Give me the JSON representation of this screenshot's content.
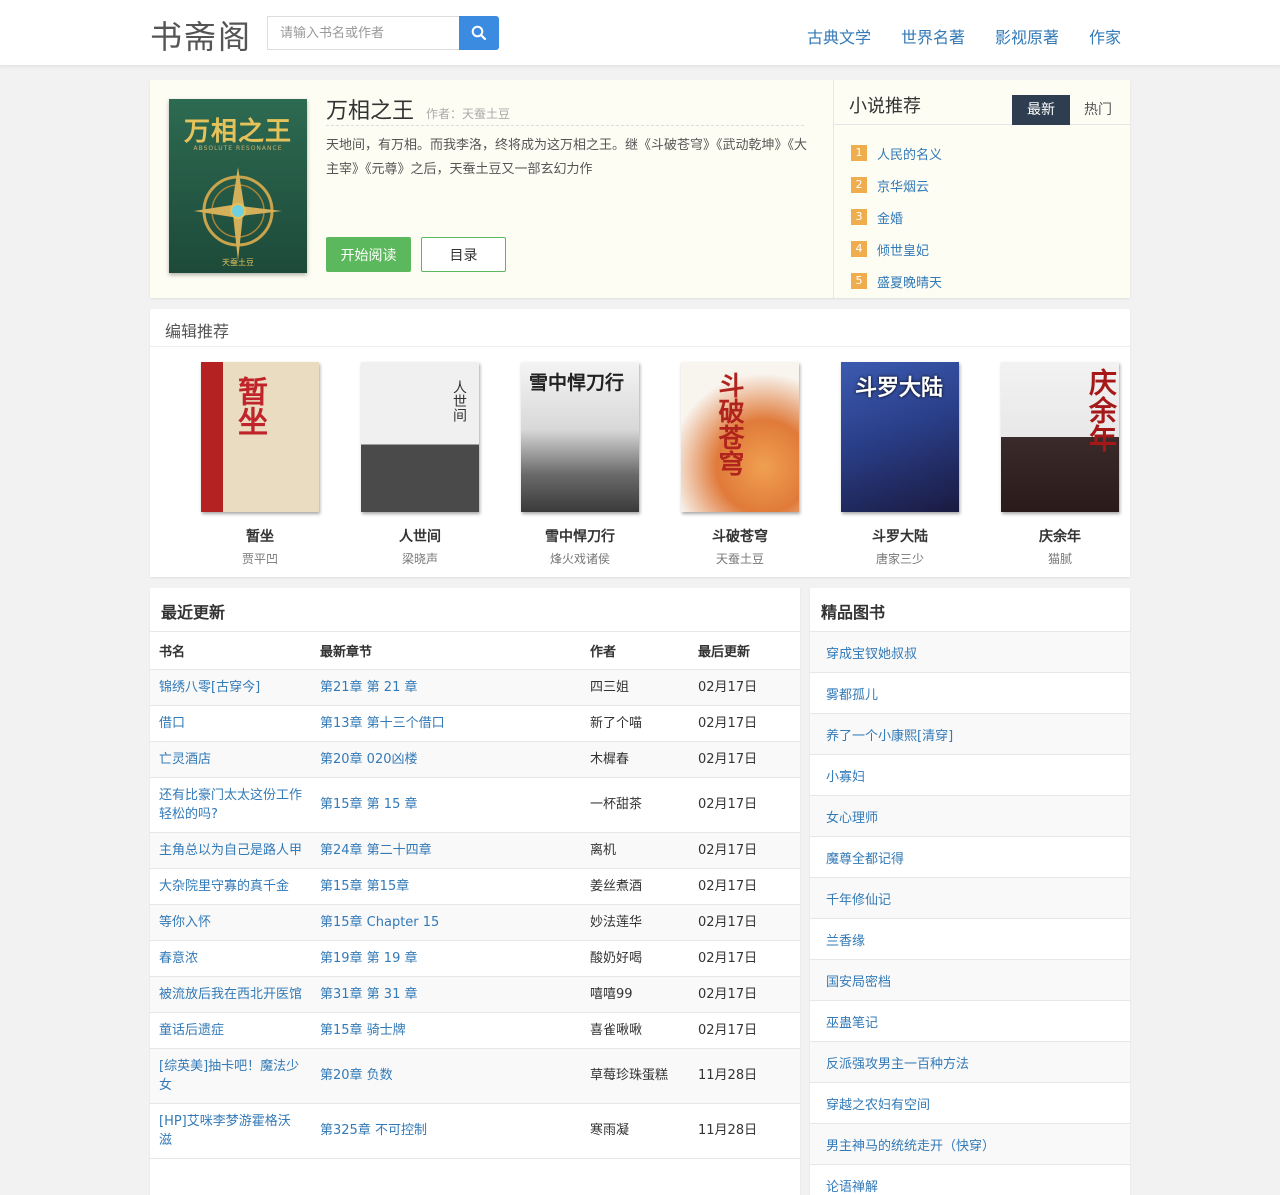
{
  "header": {
    "logo": "书斋阁",
    "search_placeholder": "请输入书名或作者",
    "nav": [
      "古典文学",
      "世界名著",
      "影视原著",
      "作家"
    ]
  },
  "featured": {
    "cover_text": "万相之王",
    "cover_subtitle": "ABSOLUTE RESONANCE",
    "cover_author": "天蚕土豆",
    "title": "万相之王",
    "author_label": "作者：",
    "author": "天蚕土豆",
    "description": "天地间，有万相。而我李洛，终将成为这万相之王。继《斗破苍穹》《武动乾坤》《大主宰》《元尊》之后，天蚕土豆又一部玄幻力作",
    "read_label": "开始阅读",
    "toc_label": "目录"
  },
  "recommend": {
    "title": "小说推荐",
    "tab_new": "最新",
    "tab_hot": "热门",
    "items": [
      {
        "rank": "1",
        "name": "人民的名义"
      },
      {
        "rank": "2",
        "name": "京华烟云"
      },
      {
        "rank": "3",
        "name": "金婚"
      },
      {
        "rank": "4",
        "name": "倾世皇妃"
      },
      {
        "rank": "5",
        "name": "盛夏晚晴天"
      }
    ]
  },
  "editor_picks": {
    "title": "编辑推荐",
    "books": [
      {
        "title": "暂坐",
        "author": "贾平凹",
        "cover_text": "暂坐",
        "color": "#c72b2b"
      },
      {
        "title": "人世间",
        "author": "梁晓声",
        "cover_text": "人世间",
        "color": "#e8e8e8"
      },
      {
        "title": "雪中悍刀行",
        "author": "烽火戏诸侯",
        "cover_text": "雪中悍刀行",
        "color": "#9a9a9a"
      },
      {
        "title": "斗破苍穹",
        "author": "天蚕土豆",
        "cover_text": "斗破苍穹",
        "color": "#e07a3a"
      },
      {
        "title": "斗罗大陆",
        "author": "唐家三少",
        "cover_text": "斗罗大陆",
        "color": "#2a3f8a"
      },
      {
        "title": "庆余年",
        "author": "猫腻",
        "cover_text": "庆余年",
        "color": "#3a2a2a"
      }
    ]
  },
  "updates": {
    "title": "最近更新",
    "columns": [
      "书名",
      "最新章节",
      "作者",
      "最后更新"
    ],
    "rows": [
      {
        "name": "锦绣八零[古穿今]",
        "chapter": "第21章 第 21 章",
        "author": "四三姐",
        "date": "02月17日"
      },
      {
        "name": "借口",
        "chapter": "第13章 第十三个借口",
        "author": "新了个喵",
        "date": "02月17日"
      },
      {
        "name": "亡灵酒店",
        "chapter": "第20章 020凶楼",
        "author": "木樨春",
        "date": "02月17日"
      },
      {
        "name": "还有比豪门太太这份工作轻松的吗?",
        "chapter": "第15章 第 15 章",
        "author": "一杯甜茶",
        "date": "02月17日"
      },
      {
        "name": "主角总以为自己是路人甲",
        "chapter": "第24章 第二十四章",
        "author": "离机",
        "date": "02月17日"
      },
      {
        "name": "大杂院里守寡的真千金",
        "chapter": "第15章 第15章",
        "author": "姜丝煮酒",
        "date": "02月17日"
      },
      {
        "name": "等你入怀",
        "chapter": "第15章 Chapter 15",
        "author": "妙法莲华",
        "date": "02月17日"
      },
      {
        "name": "春意浓",
        "chapter": "第19章 第 19 章",
        "author": "酸奶好喝",
        "date": "02月17日"
      },
      {
        "name": "被流放后我在西北开医馆",
        "chapter": "第31章 第 31 章",
        "author": "嘻嘻99",
        "date": "02月17日"
      },
      {
        "name": "童话后遗症",
        "chapter": "第15章 骑士牌",
        "author": "喜雀啾啾",
        "date": "02月17日"
      },
      {
        "name": "[综英美]抽卡吧！魔法少女",
        "chapter": "第20章 负数",
        "author": "草莓珍珠蛋糕",
        "date": "11月28日"
      },
      {
        "name": "[HP]艾咪李梦游霍格沃滋",
        "chapter": "第325章 不可控制",
        "author": "寒雨凝",
        "date": "11月28日"
      }
    ]
  },
  "premium": {
    "title": "精品图书",
    "items": [
      "穿成宝钗她叔叔",
      "雾都孤儿",
      "养了一个小康熙[清穿]",
      "小寡妇",
      "女心理师",
      "魔尊全都记得",
      "千年修仙记",
      "兰香缘",
      "国安局密档",
      "巫蛊笔记",
      "反派强攻男主一百种方法",
      "穿越之农妇有空间",
      "男主神马的统统走开（快穿）",
      "论语禅解"
    ]
  },
  "colors": {
    "brand_blue": "#337ab7",
    "search_button": "#3b8be0",
    "read_button": "#5cb85c",
    "tab_active": "#2e3e50",
    "rank_badge": "#f0ad4e"
  }
}
